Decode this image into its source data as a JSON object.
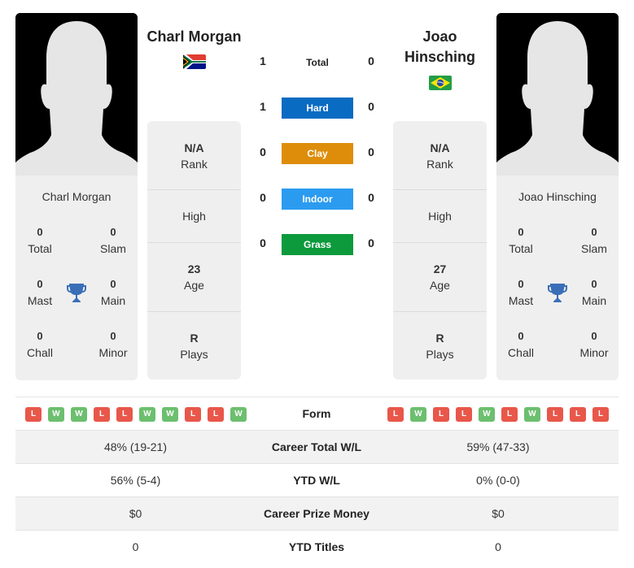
{
  "player1": {
    "name": "Charl Morgan",
    "country": "South Africa",
    "flag_icon": "south-africa-flag",
    "card_name": "Charl Morgan",
    "titles": {
      "total": {
        "value": "0",
        "label": "Total"
      },
      "slam": {
        "value": "0",
        "label": "Slam"
      },
      "mast": {
        "value": "0",
        "label": "Mast"
      },
      "main": {
        "value": "0",
        "label": "Main"
      },
      "chall": {
        "value": "0",
        "label": "Chall"
      },
      "minor": {
        "value": "0",
        "label": "Minor"
      }
    },
    "info": {
      "rank": {
        "value": "N/A",
        "label": "Rank"
      },
      "high": {
        "label": "High"
      },
      "age": {
        "value": "23",
        "label": "Age"
      },
      "plays": {
        "value": "R",
        "label": "Plays"
      }
    },
    "form": [
      "L",
      "W",
      "W",
      "L",
      "L",
      "W",
      "W",
      "L",
      "L",
      "W"
    ]
  },
  "player2": {
    "name_line1": "Joao",
    "name_line2": "Hinsching",
    "country": "Brazil",
    "flag_icon": "brazil-flag",
    "card_name": "Joao Hinsching",
    "titles": {
      "total": {
        "value": "0",
        "label": "Total"
      },
      "slam": {
        "value": "0",
        "label": "Slam"
      },
      "mast": {
        "value": "0",
        "label": "Mast"
      },
      "main": {
        "value": "0",
        "label": "Main"
      },
      "chall": {
        "value": "0",
        "label": "Chall"
      },
      "minor": {
        "value": "0",
        "label": "Minor"
      }
    },
    "info": {
      "rank": {
        "value": "N/A",
        "label": "Rank"
      },
      "high": {
        "label": "High"
      },
      "age": {
        "value": "27",
        "label": "Age"
      },
      "plays": {
        "value": "R",
        "label": "Plays"
      }
    },
    "form": [
      "L",
      "W",
      "L",
      "L",
      "W",
      "L",
      "W",
      "L",
      "L",
      "L"
    ]
  },
  "h2h": {
    "total": {
      "label": "Total",
      "p1": "1",
      "p2": "0"
    },
    "surfaces": [
      {
        "label": "Hard",
        "p1": "1",
        "p2": "0",
        "color": "#0a6bc2"
      },
      {
        "label": "Clay",
        "p1": "0",
        "p2": "0",
        "color": "#de8d0a"
      },
      {
        "label": "Indoor",
        "p1": "0",
        "p2": "0",
        "color": "#2b9bf0"
      },
      {
        "label": "Grass",
        "p1": "0",
        "p2": "0",
        "color": "#0c9a3c"
      }
    ]
  },
  "comparison": {
    "form_label": "Form",
    "rows": [
      {
        "label": "Career Total W/L",
        "p1": "48% (19-21)",
        "p2": "59% (47-33)"
      },
      {
        "label": "YTD W/L",
        "p1": "56% (5-4)",
        "p2": "0% (0-0)"
      },
      {
        "label": "Career Prize Money",
        "p1": "$0",
        "p2": "$0"
      },
      {
        "label": "YTD Titles",
        "p1": "0",
        "p2": "0"
      }
    ]
  },
  "colors": {
    "win": "#6cbf6e",
    "loss": "#e8574a",
    "trophy": "#3a6fb7"
  }
}
